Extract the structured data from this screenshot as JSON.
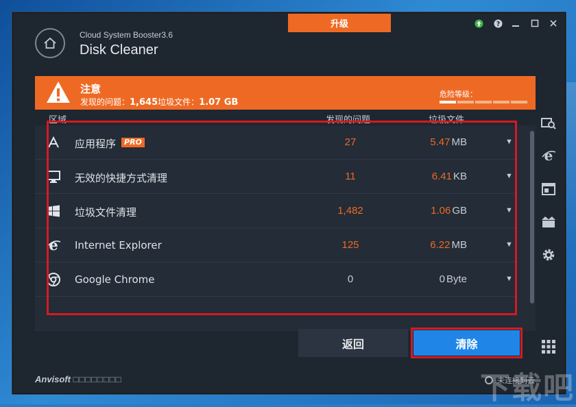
{
  "window": {
    "app_name": "Cloud System Booster3.6",
    "module_name": "Disk Cleaner",
    "upgrade_label": "升级"
  },
  "banner": {
    "title": "注意",
    "summary_prefix": "发现的问题：",
    "problem_count": "1,645",
    "files_label": "垃圾文件：",
    "total_size": "1.07 GB",
    "danger_label": "危险等级：",
    "danger_level": 0.2,
    "danger_segments": 5
  },
  "table": {
    "headers": {
      "area": "区域",
      "problems": "发现的问题",
      "files": "垃圾文件"
    },
    "rows": [
      {
        "icon": "app-store-icon",
        "name": "应用程序",
        "badge": "PRO",
        "count": "27",
        "size": "5.47",
        "unit": "MB"
      },
      {
        "icon": "monitor-icon",
        "name": "无效的快捷方式清理",
        "count": "11",
        "size": "6.41",
        "unit": "KB"
      },
      {
        "icon": "windows-logo-icon",
        "name": "垃圾文件清理",
        "count": "1,482",
        "size": "1.06",
        "unit": "GB"
      },
      {
        "icon": "internet-explorer-icon",
        "name": "Internet Explorer",
        "count": "125",
        "size": "6.22",
        "unit": "MB"
      },
      {
        "icon": "google-chrome-icon",
        "name": "Google Chrome",
        "count": "0",
        "size": "0",
        "unit": "Byte"
      }
    ]
  },
  "buttons": {
    "back": "返回",
    "clean": "清除"
  },
  "footer": {
    "brand": "Anvisoft",
    "brand_boxes": "□□□□□□□□",
    "status": "未连接到云"
  },
  "watermark": "下载吧",
  "colors": {
    "accent": "#ee6a24",
    "primary_button": "#1f86e8",
    "highlight": "#d71920"
  }
}
